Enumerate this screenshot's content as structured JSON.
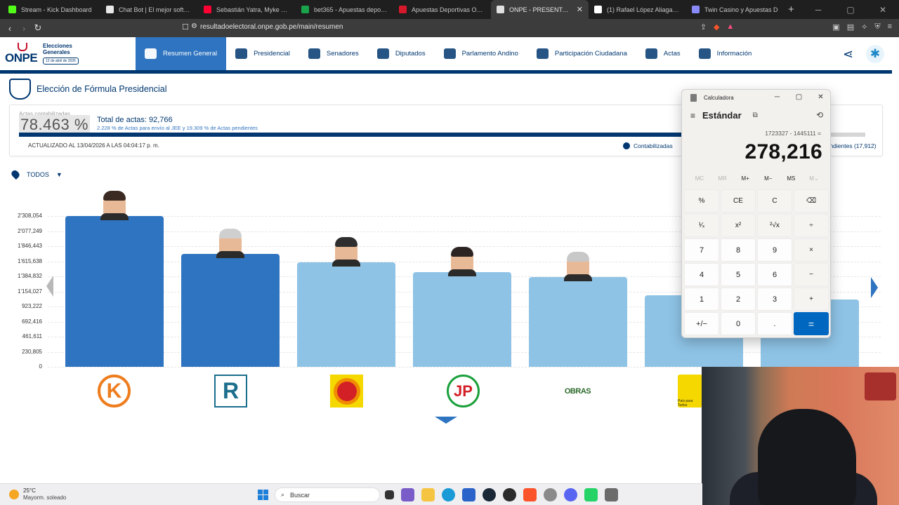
{
  "browser": {
    "tabs": [
      {
        "title": "Stream - Kick Dashboard",
        "color": "#53fc18"
      },
      {
        "title": "Chat Bot | El mejor software p",
        "color": "#e8e8e8"
      },
      {
        "title": "Sebastián Yatra, Myke Towers",
        "color": "#ff0033"
      },
      {
        "title": "bet365 - Apuestas deportivas",
        "color": "#1aa34a"
      },
      {
        "title": "Apuestas Deportivas Online |",
        "color": "#d6182b"
      },
      {
        "title": "ONPE - PRESENTACIÓN D",
        "color": "#e0e0e0",
        "active": true
      },
      {
        "title": "(1) Rafael López Aliaga (@rlop",
        "color": "#ffffff"
      },
      {
        "title": "Twin Casino y Apuestas D",
        "color": "#8a8aff"
      }
    ],
    "url": "resultadoelectoral.onpe.gob.pe/main/resumen"
  },
  "header": {
    "logo_text": "ONPE",
    "logo_title": "Elecciones Generales",
    "logo_date": "12 de abril de 2026",
    "menu": [
      {
        "label": "Resumen General",
        "active": true
      },
      {
        "label": "Presidencial"
      },
      {
        "label": "Senadores"
      },
      {
        "label": "Diputados"
      },
      {
        "label": "Parlamento Andino"
      },
      {
        "label": "Participación Ciudadana"
      },
      {
        "label": "Actas"
      },
      {
        "label": "Información"
      }
    ]
  },
  "summary": {
    "title": "Elección de Fórmula Presidencial",
    "actas_label": "Actas contabilizadas",
    "actas_pct": "78.463 %",
    "progress_fraction": 0.78463,
    "total_label": "Total de actas: 92,766",
    "total_sub": "2.228 % de Actas para envío al JEE y 19.309 % de Actas pendientes",
    "updated": "ACTUALIZADO AL 13/04/2026 A LAS 04:04:17 p. m.",
    "legend_counted": "Contabilizadas",
    "legend_pending": "pendientes (17,912)"
  },
  "filter": {
    "label": "TODOS"
  },
  "chart_data": {
    "type": "bar",
    "yticks": [
      "2'308,054",
      "2'077,249",
      "1'846,443",
      "1'615,638",
      "1'384,832",
      "1'154,027",
      "923,222",
      "692,416",
      "461,611",
      "230,805",
      "0"
    ],
    "ylim": [
      0,
      2308054
    ],
    "values": [
      2308054,
      1723327,
      1600000,
      1445111,
      1370000,
      1100000,
      1030000
    ],
    "colors": [
      "#2f74c0",
      "#2f74c0",
      "#8ec3e6",
      "#8ec3e6",
      "#8ec3e6",
      "#8ec3e6",
      "#8ec3e6"
    ],
    "party_logos": [
      "K",
      "R",
      "",
      "JP",
      "OBRAS",
      "País para Todos",
      ""
    ]
  },
  "calculator": {
    "window_title": "Calculadora",
    "mode": "Estándar",
    "expression": "1723327 - 1445111 =",
    "result": "278,216",
    "memory": [
      "MC",
      "MR",
      "M+",
      "M−",
      "MS",
      "M⌄"
    ],
    "keys": [
      "%",
      "CE",
      "C",
      "⌫",
      "¹⁄ₓ",
      "x²",
      "²√x",
      "÷",
      "7",
      "8",
      "9",
      "×",
      "4",
      "5",
      "6",
      "−",
      "1",
      "2",
      "3",
      "+",
      "+/−",
      "0",
      ".",
      "="
    ]
  },
  "taskbar": {
    "temp": "25°C",
    "weather": "Mayorm. soleado",
    "search_placeholder": "Buscar"
  }
}
